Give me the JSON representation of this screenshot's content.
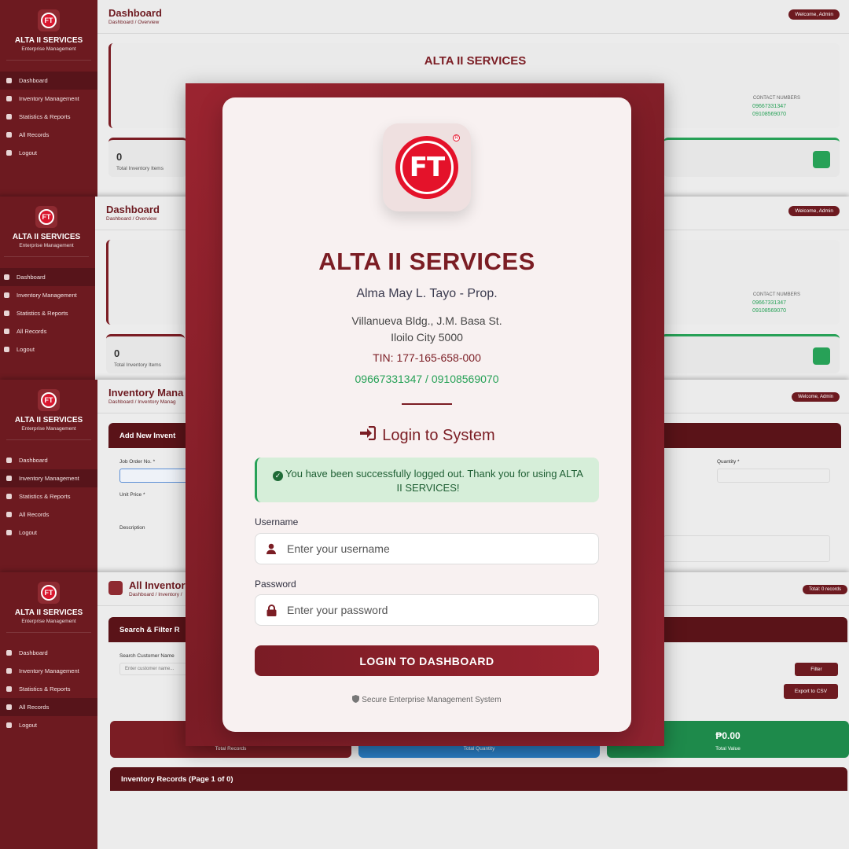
{
  "background": {
    "brand_name": "ALTA II SERVICES",
    "brand_sub": "Enterprise Management",
    "nav": [
      "Dashboard",
      "Inventory Management",
      "Statistics & Reports",
      "All Records",
      "Logout"
    ],
    "welcome": "Welcome, Admin",
    "panels": [
      {
        "title": "Dashboard",
        "crumb": "Dashboard / Overview"
      },
      {
        "title": "Dashboard",
        "crumb": "Dashboard / Overview"
      },
      {
        "title": "Inventory Mana",
        "crumb": "Dashboard / Inventory Manag"
      },
      {
        "title": "All Inventory",
        "crumb": "Dashboard / Inventory /"
      }
    ],
    "contact_label": "CONTACT NUMBERS",
    "contact_1": "09667331347",
    "contact_2": "09108569070",
    "total_inventory_value": "0",
    "total_inventory_label": "Total Inventory Items",
    "add_new_label": "Add New Invent",
    "job_order_label": "Job Order No. *",
    "quantity_label": "Quantity *",
    "unit_price_label": "Unit Price *",
    "description_label": "Description",
    "search_filter_label": "Search & Filter R",
    "search_customer_label": "Search Customer Name",
    "search_customer_placeholder": "Enter customer name...",
    "filter_button": "Filter",
    "export_button": "Export to CSV",
    "total_records_badge": "Total: 0 records",
    "total_records_label": "Total Records",
    "total_quantity_label": "Total Quantity",
    "total_value": "₱0.00",
    "total_value_label": "Total Value",
    "records_heading": "Inventory Records (Page 1 of 0)"
  },
  "login": {
    "logo_text": "FT",
    "company": "ALTA II SERVICES",
    "owner": "Alma May L. Tayo - Prop.",
    "address_line1": "Villanueva Bldg., J.M. Basa St.",
    "address_line2": "Iloilo City 5000",
    "tin": "TIN: 177-165-658-000",
    "phones": "09667331347 / 09108569070",
    "heading": "Login to System",
    "alert": "You have been successfully logged out. Thank you for using ALTA II SERVICES!",
    "username_label": "Username",
    "username_placeholder": "Enter your username",
    "password_label": "Password",
    "password_placeholder": "Enter your password",
    "submit": "LOGIN TO DASHBOARD",
    "footer": "Secure Enterprise Management System"
  },
  "colors": {
    "brand": "#7b1d24",
    "success": "#27a157",
    "sidebar": "#6d1a20"
  }
}
